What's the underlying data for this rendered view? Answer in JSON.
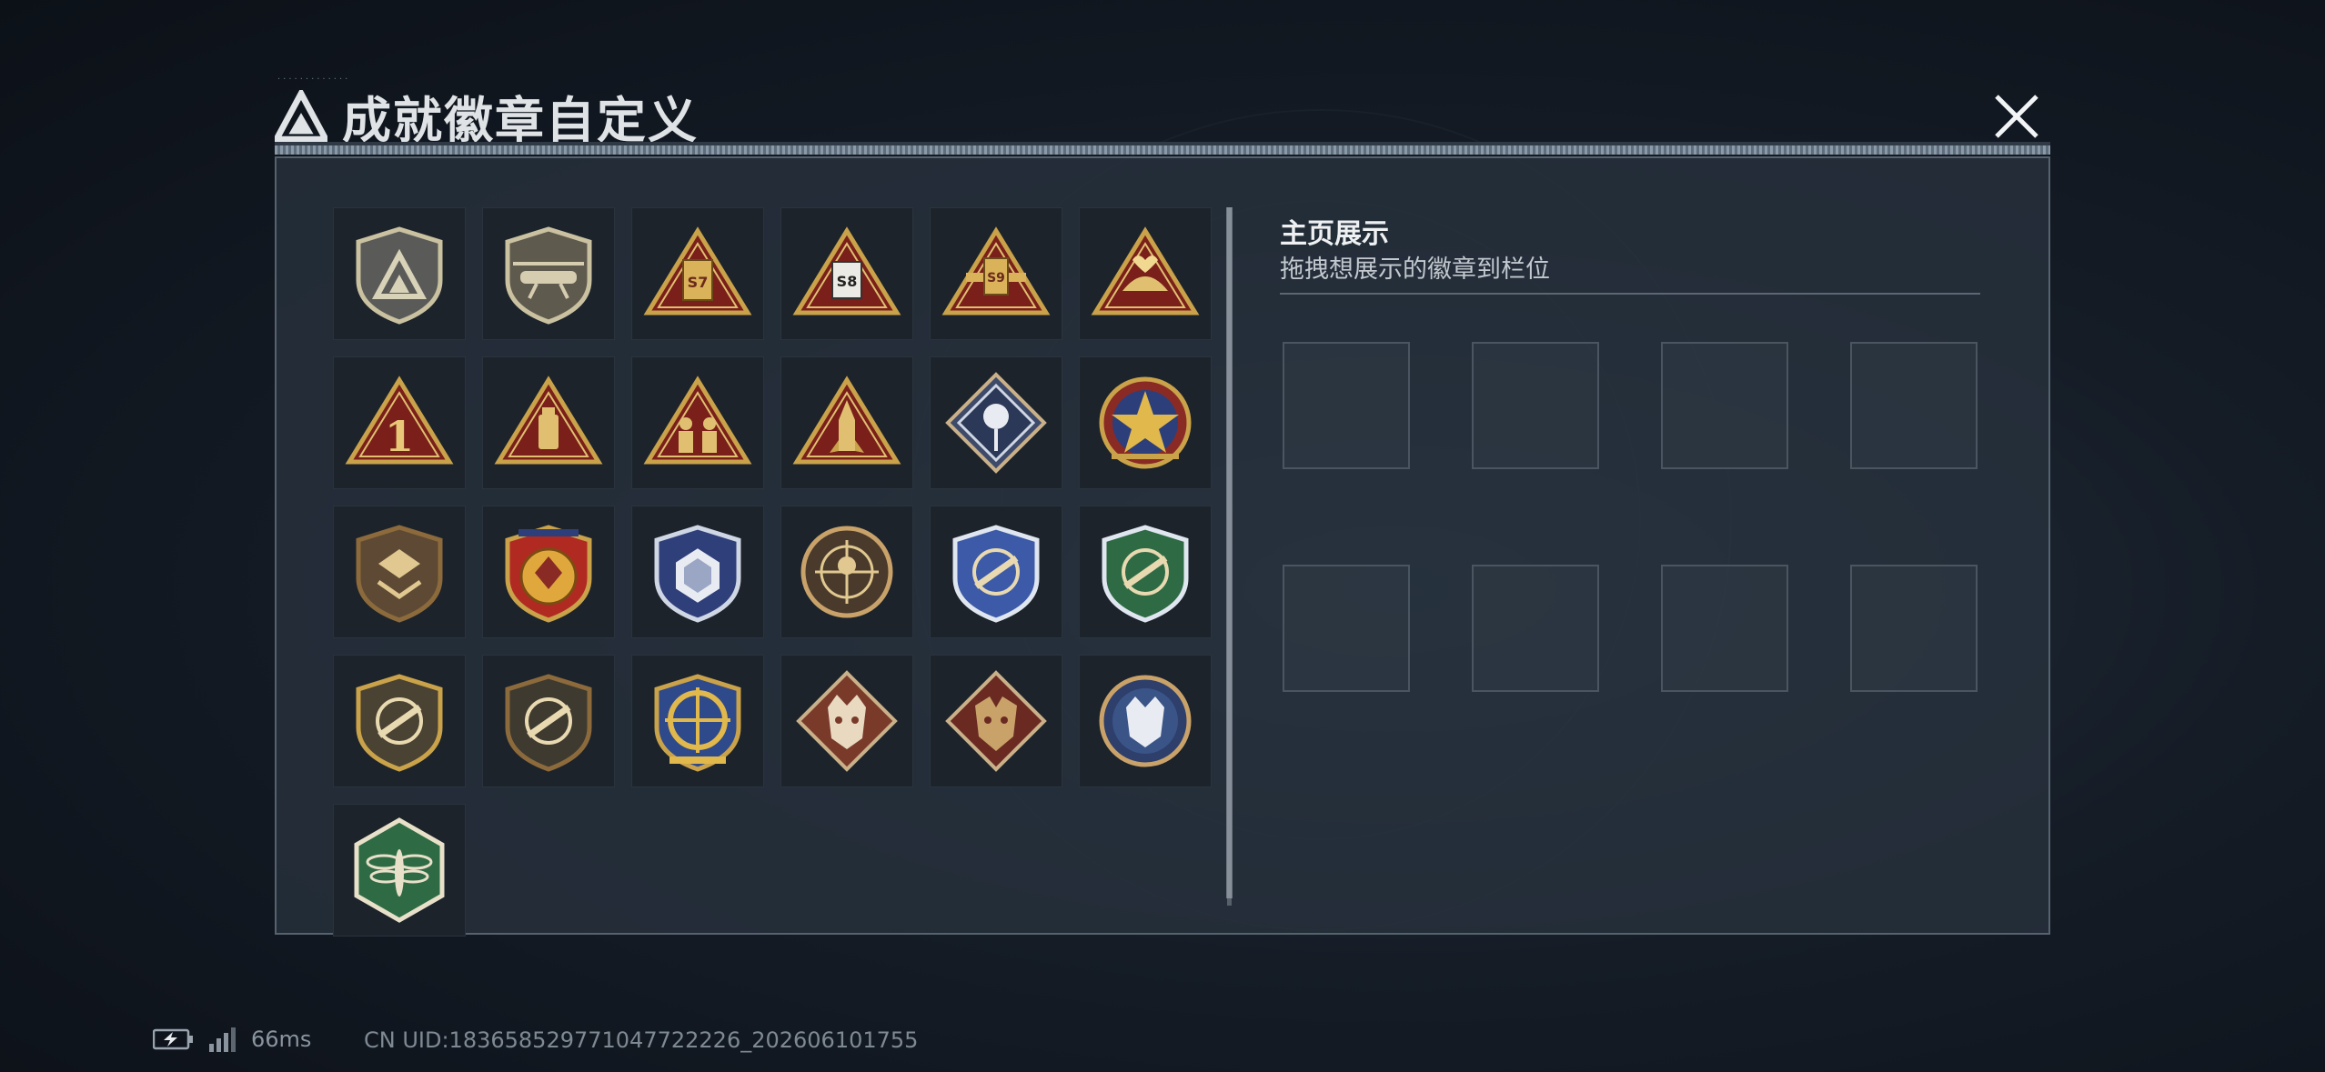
{
  "header": {
    "title": "成就徽章自定义",
    "close_label": "×"
  },
  "badges": [
    {
      "name": "season-shield-badge",
      "label": ""
    },
    {
      "name": "helicopter-shield-badge",
      "label": ""
    },
    {
      "name": "s7-triangle-badge",
      "label": "S7"
    },
    {
      "name": "s8-triangle-badge",
      "label": "S8"
    },
    {
      "name": "s9-triangle-badge",
      "label": "S9"
    },
    {
      "name": "heart-triangle-badge",
      "label": ""
    },
    {
      "name": "rank-one-triangle-badge",
      "label": "1"
    },
    {
      "name": "usb-triangle-badge",
      "label": ""
    },
    {
      "name": "soldiers-triangle-badge",
      "label": ""
    },
    {
      "name": "rocket-triangle-badge",
      "label": ""
    },
    {
      "name": "rose-diamond-badge",
      "label": ""
    },
    {
      "name": "star-medal-badge",
      "label": ""
    },
    {
      "name": "bronze-emblem-shield-badge",
      "label": ""
    },
    {
      "name": "gold-emblem-shield-badge",
      "label": ""
    },
    {
      "name": "blue-dice-shield-badge",
      "label": ""
    },
    {
      "name": "sniper-round-badge",
      "label": ""
    },
    {
      "name": "blue-rifle-shield-badge",
      "label": ""
    },
    {
      "name": "green-rifle-shield-badge",
      "label": ""
    },
    {
      "name": "gold-rifle-shield-badge",
      "label": ""
    },
    {
      "name": "bronze-rifle-shield-badge",
      "label": ""
    },
    {
      "name": "blue-target-shield-badge",
      "label": ""
    },
    {
      "name": "wolf-diamond-badge",
      "label": ""
    },
    {
      "name": "dragon-diamond-badge",
      "label": ""
    },
    {
      "name": "wolf-round-badge",
      "label": ""
    },
    {
      "name": "dragonfly-hexagon-badge",
      "label": ""
    }
  ],
  "showcase": {
    "heading": "主页展示",
    "subtitle": "拖拽想展示的徽章到栏位",
    "slot_count": 8
  },
  "status": {
    "ping": "66ms",
    "uid": "CN UID:183658529771047722226_202606101755"
  },
  "colors": {
    "gold": "#c9a24a",
    "bronze": "#8c6a3c",
    "triangle_red": "#7a1f1a",
    "blue": "#3c5aa8",
    "green": "#2e6b45",
    "panel": "#28323e"
  }
}
